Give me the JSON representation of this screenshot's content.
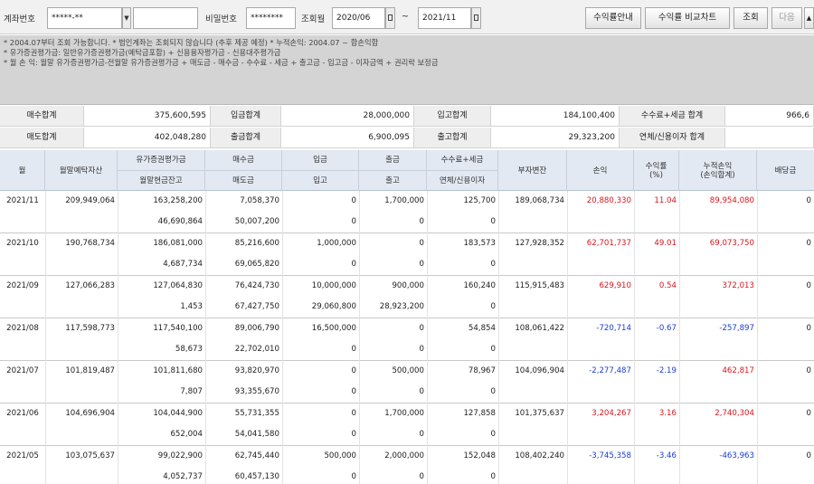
{
  "search": {
    "account_label": "계좌번호",
    "account_value": "*****-**",
    "account_name": "",
    "password_label": "비밀번호",
    "password_value": "********",
    "period_label": "조회월",
    "start_month": "2020/06",
    "tilde": "~",
    "end_month": "2021/11",
    "buttons": {
      "guide": "수익률안내",
      "compare": "수익률 비교차트",
      "inquiry": "조회",
      "next": "다음"
    }
  },
  "notes": [
    "* 2004.07부터 조회 가능합니다.    * 법인계좌는 조회되지 않습니다 (추후 제공 예정)    * 누적손익: 2004.07 ~ 합손익합",
    "* 유가증권평가금: 일반유가증권평가금(예탁금포함) + 신용융자평가금 - 신용대주평가금",
    "* 월 손 익: 월말 유가증권평가금-전월말 유가증권평가금 + 매도금 - 매수금 - 수수료 - 세금 + 출고금 - 입고금 - 이자금액 + 권리락 보정금"
  ],
  "summary": [
    {
      "label": "매수합계",
      "value": "375,600,595"
    },
    {
      "label": "입금합계",
      "value": "28,000,000"
    },
    {
      "label": "입고합계",
      "value": "184,100,400"
    },
    {
      "label": "수수료+세금 합계",
      "value": "966,6"
    },
    {
      "label": "매도합계",
      "value": "402,048,280"
    },
    {
      "label": "출금합계",
      "value": "6,900,095"
    },
    {
      "label": "출고합계",
      "value": "29,323,200"
    },
    {
      "label": "연체/신용이자 합계",
      "value": ""
    }
  ],
  "table": {
    "headers": {
      "month": "월",
      "month_end_assets": "월말예탁자산",
      "securities_eval_top": "유가증권평가금",
      "securities_eval_bottom": "월말현금잔고",
      "buy_top": "매수금",
      "buy_bottom": "매도금",
      "deposit_top": "입금",
      "deposit_bottom": "입고",
      "withdraw_top": "출금",
      "withdraw_bottom": "출고",
      "fee_top": "수수료+세금",
      "fee_bottom": "연체/신용이자",
      "change": "부자변잔",
      "pnl": "손익",
      "return_rate_top": "수익률",
      "return_rate_bottom": "(%)",
      "cum_pnl_top": "누적손익",
      "cum_pnl_bottom": "(손익합계)",
      "dividend": "배당금"
    },
    "rows": [
      {
        "month": "2021/11",
        "assets": "209,949,064",
        "sec": "163,258,200",
        "cash": "46,690,864",
        "buy": "7,058,370",
        "sell": "50,007,200",
        "dep": "0",
        "in": "0",
        "wd": "1,700,000",
        "out": "0",
        "fee": "125,700",
        "int": "0",
        "chg": "189,068,734",
        "pnl": "20,880,330",
        "pnl_color": "red",
        "rate": "11.04",
        "rate_color": "red",
        "cum": "89,954,080",
        "cum_color": "red",
        "div": "0"
      },
      {
        "month": "2021/10",
        "assets": "190,768,734",
        "sec": "186,081,000",
        "cash": "4,687,734",
        "buy": "85,216,600",
        "sell": "69,065,820",
        "dep": "1,000,000",
        "in": "0",
        "wd": "0",
        "out": "0",
        "fee": "183,573",
        "int": "0",
        "chg": "127,928,352",
        "pnl": "62,701,737",
        "pnl_color": "red",
        "rate": "49.01",
        "rate_color": "red",
        "cum": "69,073,750",
        "cum_color": "red",
        "div": "0"
      },
      {
        "month": "2021/09",
        "assets": "127,066,283",
        "sec": "127,064,830",
        "cash": "1,453",
        "buy": "76,424,730",
        "sell": "67,427,750",
        "dep": "10,000,000",
        "in": "29,060,800",
        "wd": "900,000",
        "out": "28,923,200",
        "fee": "160,240",
        "int": "0",
        "chg": "115,915,483",
        "pnl": "629,910",
        "pnl_color": "red",
        "rate": "0.54",
        "rate_color": "red",
        "cum": "372,013",
        "cum_color": "red",
        "div": "0"
      },
      {
        "month": "2021/08",
        "assets": "117,598,773",
        "sec": "117,540,100",
        "cash": "58,673",
        "buy": "89,006,790",
        "sell": "22,702,010",
        "dep": "16,500,000",
        "in": "0",
        "wd": "0",
        "out": "0",
        "fee": "54,854",
        "int": "0",
        "chg": "108,061,422",
        "pnl": "-720,714",
        "pnl_color": "blue",
        "rate": "-0.67",
        "rate_color": "blue",
        "cum": "-257,897",
        "cum_color": "blue",
        "div": "0"
      },
      {
        "month": "2021/07",
        "assets": "101,819,487",
        "sec": "101,811,680",
        "cash": "7,807",
        "buy": "93,820,970",
        "sell": "93,355,670",
        "dep": "0",
        "in": "0",
        "wd": "500,000",
        "out": "0",
        "fee": "78,967",
        "int": "0",
        "chg": "104,096,904",
        "pnl": "-2,277,487",
        "pnl_color": "blue",
        "rate": "-2.19",
        "rate_color": "blue",
        "cum": "462,817",
        "cum_color": "red",
        "div": "0"
      },
      {
        "month": "2021/06",
        "assets": "104,696,904",
        "sec": "104,044,900",
        "cash": "652,004",
        "buy": "55,731,355",
        "sell": "54,041,580",
        "dep": "0",
        "in": "0",
        "wd": "1,700,000",
        "out": "0",
        "fee": "127,858",
        "int": "0",
        "chg": "101,375,637",
        "pnl": "3,204,267",
        "pnl_color": "red",
        "rate": "3.16",
        "rate_color": "red",
        "cum": "2,740,304",
        "cum_color": "red",
        "div": "0"
      },
      {
        "month": "2021/05",
        "assets": "103,075,637",
        "sec": "99,022,900",
        "cash": "4,052,737",
        "buy": "62,745,440",
        "sell": "60,457,130",
        "dep": "500,000",
        "in": "0",
        "wd": "2,000,000",
        "out": "0",
        "fee": "152,048",
        "int": "0",
        "chg": "108,402,240",
        "pnl": "-3,745,358",
        "pnl_color": "blue",
        "rate": "-3.46",
        "rate_color": "blue",
        "cum": "-463,963",
        "cum_color": "blue",
        "div": "0"
      }
    ]
  },
  "colors": {
    "positive": "#d9161d",
    "negative": "#1a3dd6",
    "header_bg": "#e3e9f2",
    "notes_bg": "#d4d4d4"
  }
}
